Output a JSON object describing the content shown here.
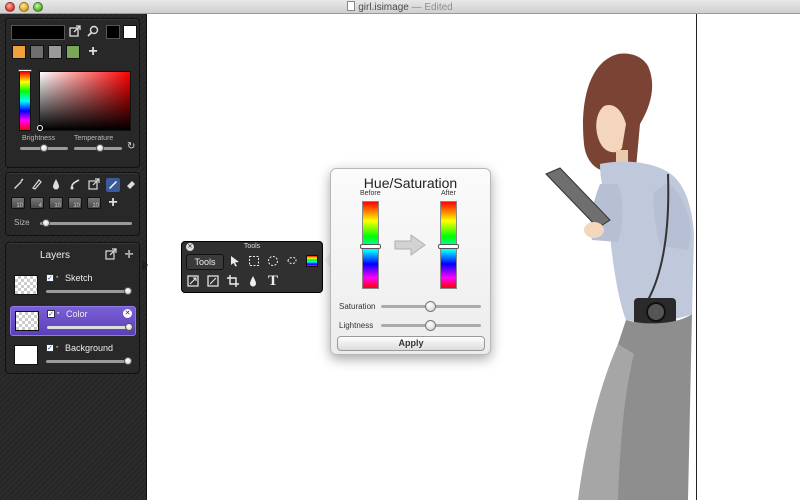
{
  "window": {
    "title": "girl.isimage",
    "edited": "— Edited"
  },
  "colors": {
    "primary": "#000000",
    "secondary": "#ffffff",
    "recent": [
      "#f0a23a",
      "#6e6e6e",
      "#9a9a9a",
      "#7aa85a",
      "#8fbf6a"
    ],
    "hue_selected": "#ff0000",
    "accent_selected_layer": "#6a4fd0"
  },
  "color_panel": {
    "brightness_label": "Brightness",
    "temperature_label": "Temperature",
    "brightness_value": 0.5,
    "temperature_value": 0.55,
    "icons": [
      "export-icon",
      "eyedropper-icon",
      "add-icon",
      "reset-icon"
    ]
  },
  "tools_panel": {
    "size_label": "Size",
    "size_value": 0.05,
    "brush_sizes": [
      "10",
      "4",
      "10",
      "10",
      "10",
      "7"
    ],
    "icons": [
      "brush-icon",
      "pencil-icon",
      "ink-drop-icon",
      "smudge-icon",
      "export-icon",
      "eraser-icon"
    ]
  },
  "layers": {
    "title": "Layers",
    "items": [
      {
        "name": "Sketch",
        "visible": true,
        "opacity": 1.0,
        "selected": false
      },
      {
        "name": "Color",
        "visible": true,
        "opacity": 1.0,
        "selected": true
      },
      {
        "name": "Background",
        "visible": true,
        "opacity": 1.0,
        "selected": false
      }
    ]
  },
  "tools_palette": {
    "title": "Tools",
    "tab_label": "Tools",
    "tool_icons": [
      "pointer-icon",
      "rect-select-icon",
      "ellipse-select-icon",
      "lasso-select-icon",
      "hue-saturation-icon",
      "resize-icon",
      "transform-icon",
      "crop-icon",
      "drop-icon",
      "text-icon"
    ]
  },
  "hue_saturation": {
    "title": "Hue/Saturation",
    "before_label": "Before",
    "after_label": "After",
    "before_hue_value": 0.5,
    "after_hue_value": 0.5,
    "saturation_label": "Saturation",
    "saturation_value": 0.5,
    "lightness_label": "Lightness",
    "lightness_value": 0.5,
    "apply_label": "Apply"
  }
}
